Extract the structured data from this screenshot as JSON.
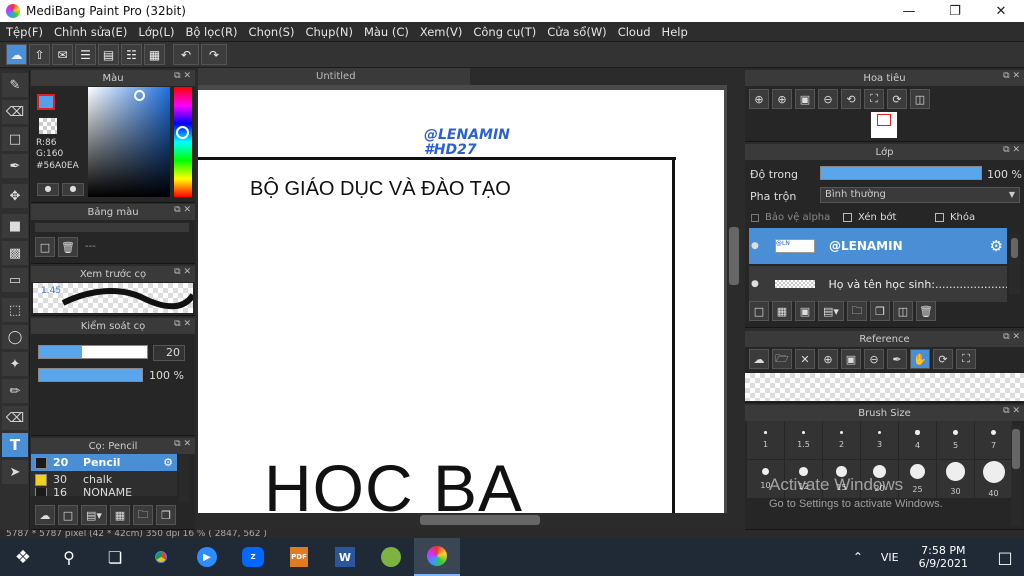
{
  "window": {
    "title": "MediBang Paint Pro (32bit)"
  },
  "menu": [
    "Tệp(F)",
    "Chỉnh sửa(E)",
    "Lớp(L)",
    "Bộ lọc(R)",
    "Chọn(S)",
    "Chụp(N)",
    "Màu (C)",
    "Xem(V)",
    "Công cụ(T)",
    "Cửa sổ(W)",
    "Cloud",
    "Help"
  ],
  "panels": {
    "color": {
      "title": "Màu",
      "r": "R:86",
      "g": "G:160",
      "hex": "#56A0EA",
      "fg_color": "#56a0ea"
    },
    "palette": {
      "title": "Bảng màu",
      "value": "---"
    },
    "brush_preview": {
      "title": "Xem trước cọ",
      "size": "1.45"
    },
    "brush_control": {
      "title": "Kiểm soát cọ",
      "size": "20",
      "opacity": "100 %",
      "size_level": 0.4,
      "opacity_level": 1.0
    },
    "brush": {
      "title": "Cọ: Pencil",
      "items": [
        {
          "size": "20",
          "name": "Pencil",
          "color": "#1a1a1a"
        },
        {
          "size": "30",
          "name": "chalk",
          "color": "#f0d020"
        },
        {
          "size": "16",
          "name": "NONAME",
          "color": "#1a1a1a"
        }
      ]
    }
  },
  "canvas": {
    "tab": "Untitled",
    "watermark1": "@LENAMIN",
    "watermark2": "#HD27",
    "line1": "BỘ GIÁO DỤC VÀ ĐÀO TẠO",
    "big": "HỌC BẠ"
  },
  "navigator": {
    "title": "Hoa tiêu"
  },
  "layer": {
    "title": "Lớp",
    "opacity_label": "Độ trong",
    "opacity_value": "100 %",
    "blend_label": "Pha trộn",
    "blend_value": "Bình thường",
    "protect_alpha": "Bảo vệ alpha",
    "clipping": "Xén bớt",
    "lock": "Khóa",
    "layers": [
      {
        "name": "@LENAMIN"
      },
      {
        "name": "Họ và tên học sinh:........................"
      }
    ]
  },
  "reference": {
    "title": "Reference"
  },
  "brush_size": {
    "title": "Brush Size",
    "sizes": [
      "1",
      "1.5",
      "2",
      "3",
      "4",
      "5",
      "7",
      "10",
      "12",
      "15",
      "20",
      "25",
      "30",
      "40"
    ]
  },
  "activation": {
    "line1": "Activate Windows",
    "line2": "Go to Settings to activate Windows."
  },
  "statusbar": {
    "text": "5787 * 5787 pixel   (42 * 42cm)   350 dpi   16 %   ( 2847, 562 )"
  },
  "taskbar": {
    "lang": "VIE",
    "time": "7:58 PM",
    "date": "6/9/2021"
  }
}
